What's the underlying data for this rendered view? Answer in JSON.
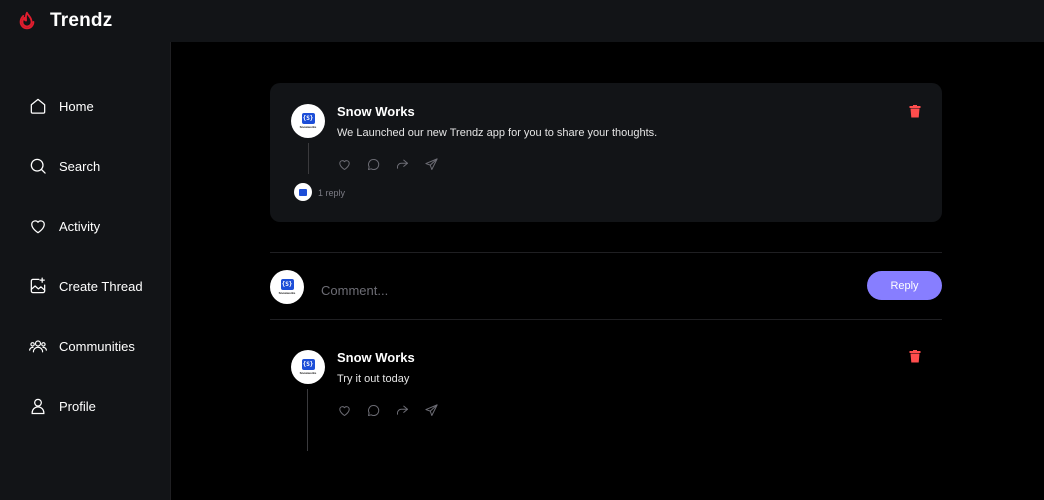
{
  "app": {
    "brand": "Trendz",
    "logo_icon": "flame-icon",
    "accent": "#877eff",
    "delete_color": "#ff4d4d"
  },
  "sidebar": {
    "items": [
      {
        "label": "Home",
        "icon": "home-icon"
      },
      {
        "label": "Search",
        "icon": "search-icon"
      },
      {
        "label": "Activity",
        "icon": "heart-icon"
      },
      {
        "label": "Create Thread",
        "icon": "create-thread-icon"
      },
      {
        "label": "Communities",
        "icon": "communities-icon"
      },
      {
        "label": "Profile",
        "icon": "user-icon"
      }
    ]
  },
  "thread": {
    "author": "Snow Works",
    "avatar_badge": "{S}",
    "avatar_caption": "Snowworks",
    "content": "We Launched our new Trendz app for you to share your thoughts.",
    "reply_count": "1 reply"
  },
  "comment_form": {
    "placeholder": "Comment...",
    "button_label": "Reply"
  },
  "comments": [
    {
      "author": "Snow Works",
      "content": "Try it out today"
    }
  ]
}
